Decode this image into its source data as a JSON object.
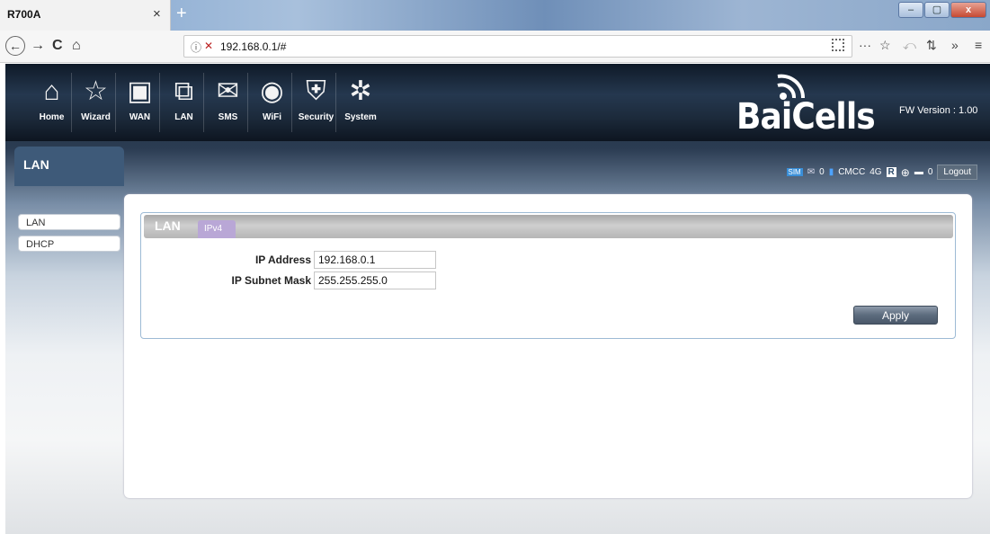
{
  "browser": {
    "tab_title": "R700A",
    "tab_close": "×",
    "new_tab": "+",
    "window_buttons": [
      "–",
      "▢",
      "x"
    ],
    "url": "192.168.0.1/#",
    "nav": {
      "back": "←",
      "forward": "→",
      "reload": "C",
      "home": "⌂",
      "more": "···",
      "bookmark": "☆",
      "history": "⤺",
      "crop": "⇅",
      "overflow": "»",
      "menu": "≡"
    }
  },
  "header": {
    "menu": [
      {
        "label": "Home",
        "icon": "⌂"
      },
      {
        "label": "Wizard",
        "icon": "☆"
      },
      {
        "label": "WAN",
        "icon": "▣"
      },
      {
        "label": "LAN",
        "icon": "⧉"
      },
      {
        "label": "SMS",
        "icon": "✉"
      },
      {
        "label": "WiFi",
        "icon": "◉"
      },
      {
        "label": "Security",
        "icon": "⛨"
      },
      {
        "label": "System",
        "icon": "✲"
      }
    ],
    "logo_text": "BaiCells",
    "fw_version": "FW Version : 1.00"
  },
  "page": {
    "title": "LAN"
  },
  "status": {
    "sms_count": "0",
    "operator": "CMCC",
    "network": "4G",
    "connected_count": "0",
    "logout_label": "Logout"
  },
  "sidebar": {
    "items": [
      {
        "label": "LAN"
      },
      {
        "label": "DHCP"
      }
    ]
  },
  "main": {
    "box_title": "LAN",
    "tab_label": "IPv4",
    "fields": {
      "ip_address": {
        "label": "IP Address",
        "value": "192.168.0.1"
      },
      "subnet_mask": {
        "label": "IP Subnet Mask",
        "value": "255.255.255.0"
      }
    },
    "apply_label": "Apply"
  },
  "colors": {
    "header_bg": "#1c2a3b",
    "page_head_bg": "#3e5a79",
    "tab_accent": "#b9a7d6",
    "box_border": "#9dbad5"
  }
}
